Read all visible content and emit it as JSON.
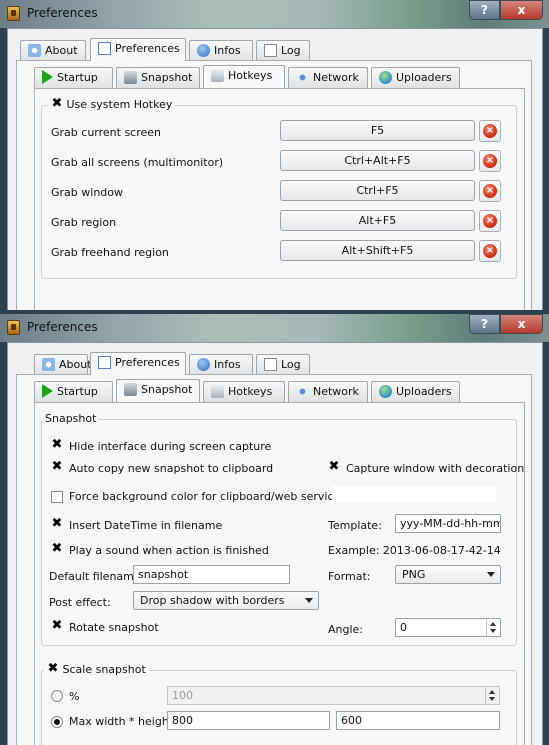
{
  "window_title": "Preferences",
  "caption_buttons": {
    "help": "?",
    "close": "x"
  },
  "main_tabs": [
    "About",
    "Preferences",
    "Infos",
    "Log"
  ],
  "sub_tabs": [
    "Startup",
    "Snapshot",
    "Hotkeys",
    "Network",
    "Uploaders"
  ],
  "hotkeys": {
    "use_system_hotkey": {
      "label": "Use system  Hotkey",
      "checked": true
    },
    "rows": [
      {
        "label": "Grab current screen",
        "key": "F5"
      },
      {
        "label": "Grab all screens (multimonitor)",
        "key": "Ctrl+Alt+F5"
      },
      {
        "label": "Grab window",
        "key": "Ctrl+F5"
      },
      {
        "label": "Grab region",
        "key": "Alt+F5"
      },
      {
        "label": "Grab freehand region",
        "key": "Alt+Shift+F5"
      }
    ]
  },
  "snapshot": {
    "group_title": "Snapshot",
    "hide_interface": {
      "label": "Hide interface during screen capture",
      "checked": true
    },
    "auto_copy": {
      "label": "Auto copy new snapshot to clipboard",
      "checked": true
    },
    "capture_decoration": {
      "label": "Capture window with decoration",
      "checked": true
    },
    "force_bg": {
      "label": "Force background color for clipboard/web services",
      "checked": false
    },
    "insert_datetime": {
      "label": "Insert DateTime in filename",
      "checked": true
    },
    "play_sound": {
      "label": "Play a sound when action is finished",
      "checked": true
    },
    "template_label": "Template:",
    "template_value": "yyy-MM-dd-hh-mm-ss",
    "example_label": "Example: 2013-06-08-17-42-14",
    "default_filename_label": "Default filename:",
    "default_filename_value": "snapshot",
    "format_label": "Format:",
    "format_value": "PNG",
    "post_effect_label": "Post effect:",
    "post_effect_value": "Drop shadow with borders",
    "rotate": {
      "label": "Rotate snapshot",
      "checked": true
    },
    "angle_label": "Angle:",
    "angle_value": "0"
  },
  "scale": {
    "group_title": "Scale snapshot",
    "checked": true,
    "percent_label": "%",
    "percent_value": "100",
    "max_label": "Max width * height",
    "width_value": "800",
    "height_value": "600",
    "selected": "max"
  },
  "check_mark": "✖"
}
